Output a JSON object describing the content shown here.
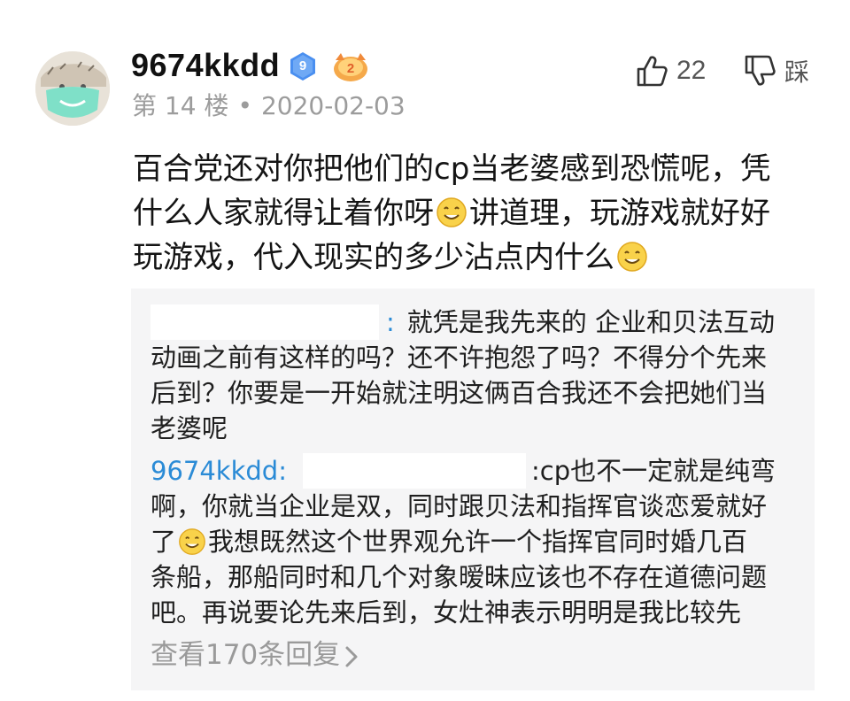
{
  "post": {
    "username": "9674kkdd",
    "level": "9",
    "floor": "第 14 楼",
    "separator": "•",
    "date": "2020-02-03",
    "likes": "22",
    "dislike_label": "踩",
    "content_lines": [
      "百合党还对你把他们的cp当老婆感到恐慌呢，凭",
      "什么人家就得让着你呀",
      "讲道理，玩游戏就好好",
      "玩游戏，代入现实的多少沾点内什么"
    ]
  },
  "replies": [
    {
      "separator": ":",
      "lines": [
        "就凭是我先来的 企业和贝法互动",
        "动画之前有这样的吗？还不许抱怨了吗？不得分个先来",
        "后到？你要是一开始就注明这俩百合我还不会把她们当",
        "老婆呢"
      ]
    },
    {
      "author": "9674kkdd:",
      "line1_tail": ":cp也不一定就是纯弯",
      "lines": [
        "啊，你就当企业是双，同时跟贝法和指挥官谈恋爱就好",
        "了",
        "我想既然这个世界观允许一个指挥官同时婚几百",
        "条船，那船同时和几个对象暧昧应该也不存在道德问题",
        "吧。再说要论先来后到，女灶神表示明明是我比较先"
      ]
    }
  ],
  "view_replies": "查看170条回复",
  "icons": [
    "avatar",
    "level-badge",
    "special-badge",
    "thumbs-up-icon",
    "thumbs-down-icon",
    "smile-emoji",
    "chevron-right-icon"
  ],
  "colors": {
    "link": "#2b8bd6",
    "meta": "#9c9c9c",
    "reply_bg": "#f5f5f6",
    "badge_blue": "#4a8ff0"
  }
}
